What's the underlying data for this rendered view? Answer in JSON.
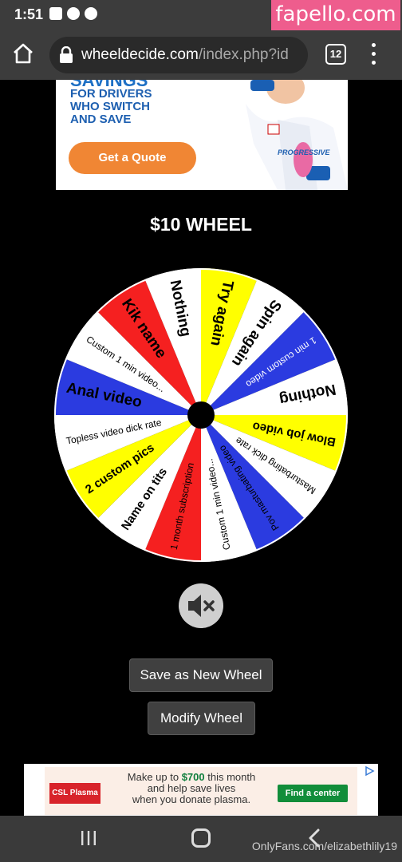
{
  "status_bar": {
    "time": "1:51",
    "watermark": "fapello.com"
  },
  "browser": {
    "url_host": "wheeldecide.com",
    "url_path": "/index.php?id",
    "tab_count": "12"
  },
  "top_ad": {
    "headline": "SAVINGS",
    "body_lines": [
      "FOR DRIVERS",
      "WHO SWITCH",
      "AND SAVE"
    ],
    "cta": "Get a Quote",
    "brand": "PROGRESSIVE"
  },
  "wheel": {
    "title": "$10 WHEEL",
    "slices": [
      {
        "label": "Try again",
        "color": "#ffff00",
        "text_color": "#000000"
      },
      {
        "label": "Spin again",
        "color": "#ffffff",
        "text_color": "#000000"
      },
      {
        "label": "1 min custom video",
        "color": "#2b3be0",
        "text_color": "#ffffff"
      },
      {
        "label": "Nothing",
        "color": "#ffffff",
        "text_color": "#000000"
      },
      {
        "label": "Blow job video",
        "color": "#ffff00",
        "text_color": "#000000"
      },
      {
        "label": "Masturbating dick rate",
        "color": "#ffffff",
        "text_color": "#000000"
      },
      {
        "label": "Pov masturbating video",
        "color": "#2b3be0",
        "text_color": "#000000"
      },
      {
        "label": "Custom 1 min video...",
        "color": "#ffffff",
        "text_color": "#000000"
      },
      {
        "label": "1 month subscription",
        "color": "#f52020",
        "text_color": "#000000"
      },
      {
        "label": "Name on tits",
        "color": "#ffffff",
        "text_color": "#000000"
      },
      {
        "label": "2 custom pics",
        "color": "#ffff00",
        "text_color": "#000000"
      },
      {
        "label": "Topless video dick rate",
        "color": "#ffffff",
        "text_color": "#000000"
      },
      {
        "label": "Anal video",
        "color": "#2b3be0",
        "text_color": "#000000"
      },
      {
        "label": "Custom 1 min video...",
        "color": "#ffffff",
        "text_color": "#000000"
      },
      {
        "label": "Kik name",
        "color": "#f52020",
        "text_color": "#000000"
      },
      {
        "label": "Nothing",
        "color": "#ffffff",
        "text_color": "#000000"
      }
    ]
  },
  "buttons": {
    "save": "Save as New Wheel",
    "modify": "Modify Wheel"
  },
  "bottom_ad": {
    "logo": "CSL Plasma",
    "msg_prefix": "Make up to ",
    "amount": "$700",
    "msg_suffix": " this month",
    "line2": "and help save lives",
    "line3": "when you donate plasma.",
    "cta": "Find a center"
  },
  "nav_watermark": "OnlyFans.com/elizabethlily19"
}
